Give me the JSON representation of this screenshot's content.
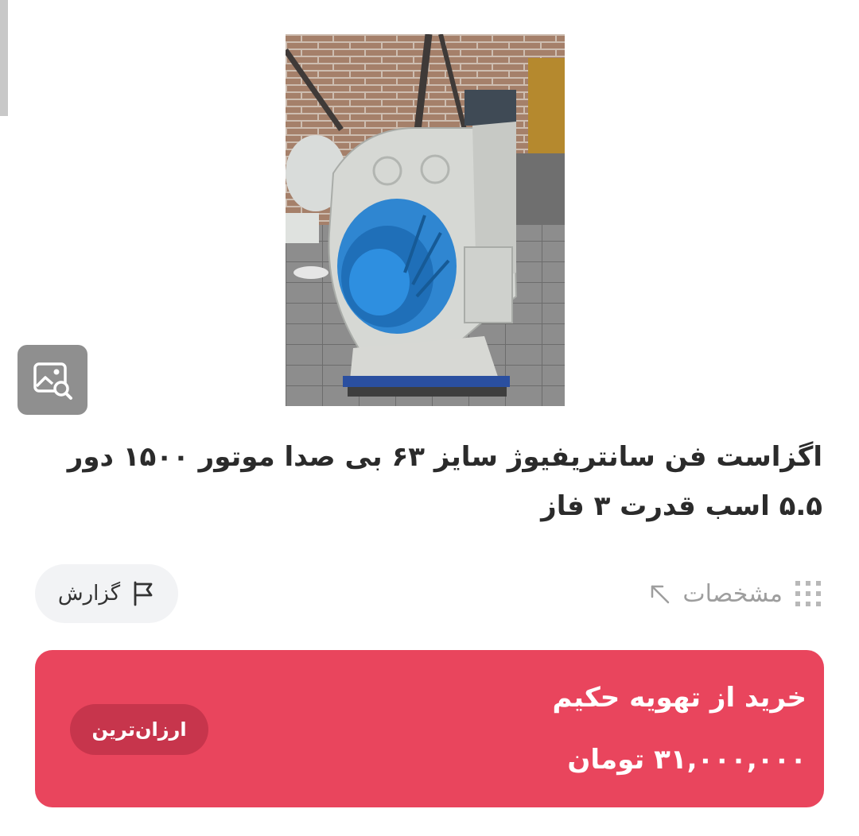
{
  "product": {
    "title": "اگزاست فن سانتریفیوژ سایز ۶۳ بی صدا موتور ۱۵۰۰ دور ۵.۵ اسب قدرت ۳ فاز",
    "image_icon": "image-search-icon"
  },
  "actions": {
    "specs_label": "مشخصات",
    "specs_icons": [
      "grid-dots-icon",
      "arrow-up-left-icon"
    ],
    "report_label": "گزارش",
    "report_icon": "flag-icon"
  },
  "offer": {
    "seller": "خرید از تهویه حکیم",
    "price": "۳۱,۰۰۰,۰۰۰ تومان",
    "badge": "ارزان‌ترین",
    "card_color": "#e9455d",
    "badge_color": "#c7354c"
  }
}
